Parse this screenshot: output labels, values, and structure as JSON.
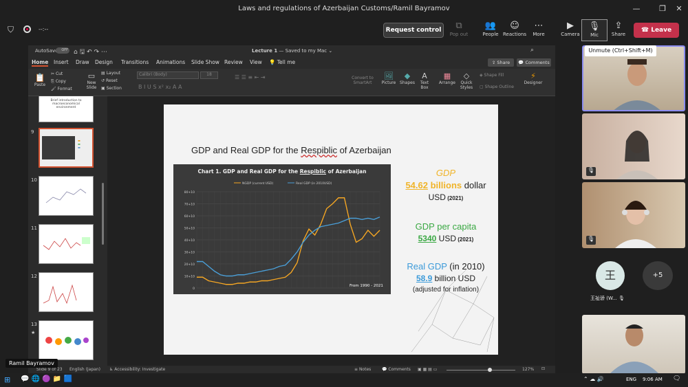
{
  "window": {
    "title": "Laws and regulations of Azerbaijan Customs/Ramil Bayramov"
  },
  "teams": {
    "timer": "--:--",
    "request_control": "Request control",
    "pop_out": "Pop out",
    "people": "People",
    "reactions": "Reactions",
    "more": "More",
    "camera": "Camera",
    "mic": "Mic",
    "share": "Share",
    "leave": "Leave",
    "unmute_tip": "Unmute (Ctrl+Shift+M)"
  },
  "ppt": {
    "autosave": "AutoSave",
    "autosave_state": "OFF",
    "doc_title": "Lecture 1",
    "saved": " — Saved to my Mac ⌄",
    "tabs": [
      "Home",
      "Insert",
      "Draw",
      "Design",
      "Transitions",
      "Animations",
      "Slide Show",
      "Review",
      "View",
      "Tell me"
    ],
    "share": "Share",
    "comments": "Comments",
    "ribbon": {
      "paste": "Paste",
      "cut": "Cut",
      "copy": "Copy",
      "format": "Format",
      "new_slide": "New Slide",
      "layout": "Layout",
      "reset": "Reset",
      "section": "Section",
      "font": "Calibri (Body)",
      "size": "18",
      "convert": "Convert to SmartArt",
      "picture": "Picture",
      "shapes": "Shapes",
      "textbox": "Text Box",
      "arrange": "Arrange",
      "quick": "Quick Styles",
      "shape_fill": "Shape Fill",
      "shape_outline": "Shape Outline",
      "designer": "Designer"
    },
    "thumbs": [
      {
        "num": "",
        "text": "Brief introduction to macroeconomical environment"
      },
      {
        "num": "9",
        "text": ""
      },
      {
        "num": "10",
        "text": ""
      },
      {
        "num": "11",
        "text": ""
      },
      {
        "num": "12",
        "text": ""
      },
      {
        "num": "13",
        "text": ""
      }
    ],
    "status": {
      "slide": "Slide 9 of 23",
      "lang": "English (Japan)",
      "access": "Accessibility: Investigate",
      "notes": "Notes",
      "comments": "Comments",
      "zoom": "127%"
    }
  },
  "slide": {
    "title_pre": "GDP and Real GDP for the ",
    "title_mid": "Respiblic",
    "title_post": " of Azerbaijan",
    "gdp_label": "GDP",
    "gdp_value": "54.62",
    "gdp_unit": " billions",
    "gdp_dollar": " dollar",
    "gdp_usd": "USD",
    "gdp_year": " (2021)",
    "pc_label": "GDP per capita",
    "pc_value": "5340",
    "pc_usd": " USD",
    "pc_year": " (2021)",
    "real_label": "Real GDP",
    "real_year_lbl": " (in 2010)",
    "real_value": "58.9",
    "real_unit": " billion USD",
    "real_note": "(adjusted for inflation)"
  },
  "chart_data": {
    "type": "line",
    "title_pre": "Chart 1. GDP and Real GDP for the ",
    "title_mid": "Respiblic",
    "title_post": " of Azerbaijan",
    "x": [
      1990,
      1991,
      1992,
      1993,
      1994,
      1995,
      1996,
      1997,
      1998,
      1999,
      2000,
      2001,
      2002,
      2003,
      2004,
      2005,
      2006,
      2007,
      2008,
      2009,
      2010,
      2011,
      2012,
      2013,
      2014,
      2015,
      2016,
      2017,
      2018,
      2019,
      2020,
      2021
    ],
    "yticks": [
      "0",
      "10+10",
      "20+10",
      "30+10",
      "40+10",
      "50+10",
      "60+10",
      "70+10",
      "80+10"
    ],
    "ylim": [
      0,
      80
    ],
    "series": [
      {
        "name": "NGDP (current USD)",
        "color": "#f5a623",
        "values": [
          9,
          9,
          6,
          5,
          4,
          3,
          3,
          4,
          4,
          5,
          5,
          6,
          6,
          7,
          8,
          9,
          13,
          21,
          39,
          49,
          44,
          53,
          66,
          70,
          75,
          75,
          53,
          38,
          41,
          48,
          43,
          48
        ]
      },
      {
        "name": "Real GDP (in 2010USD)",
        "color": "#4a9fd8",
        "values": [
          22,
          22,
          18,
          14,
          11,
          10,
          10,
          11,
          11,
          12,
          13,
          14,
          15,
          16,
          18,
          19,
          24,
          30,
          38,
          44,
          48,
          51,
          52,
          53,
          54,
          56,
          58,
          58,
          57,
          58,
          57,
          59
        ]
      }
    ],
    "footnote": "From 1990 - 2021"
  },
  "participants": [
    {
      "name": ""
    },
    {
      "name": ""
    },
    {
      "name": ""
    },
    {
      "initial": "王",
      "name": "王祉骄 (W..."
    },
    {
      "more": "+5"
    },
    {
      "name": ""
    }
  ],
  "presenter": "Ramil Bayramov",
  "taskbar": {
    "lang": "ENG",
    "time": "9:06 AM"
  }
}
